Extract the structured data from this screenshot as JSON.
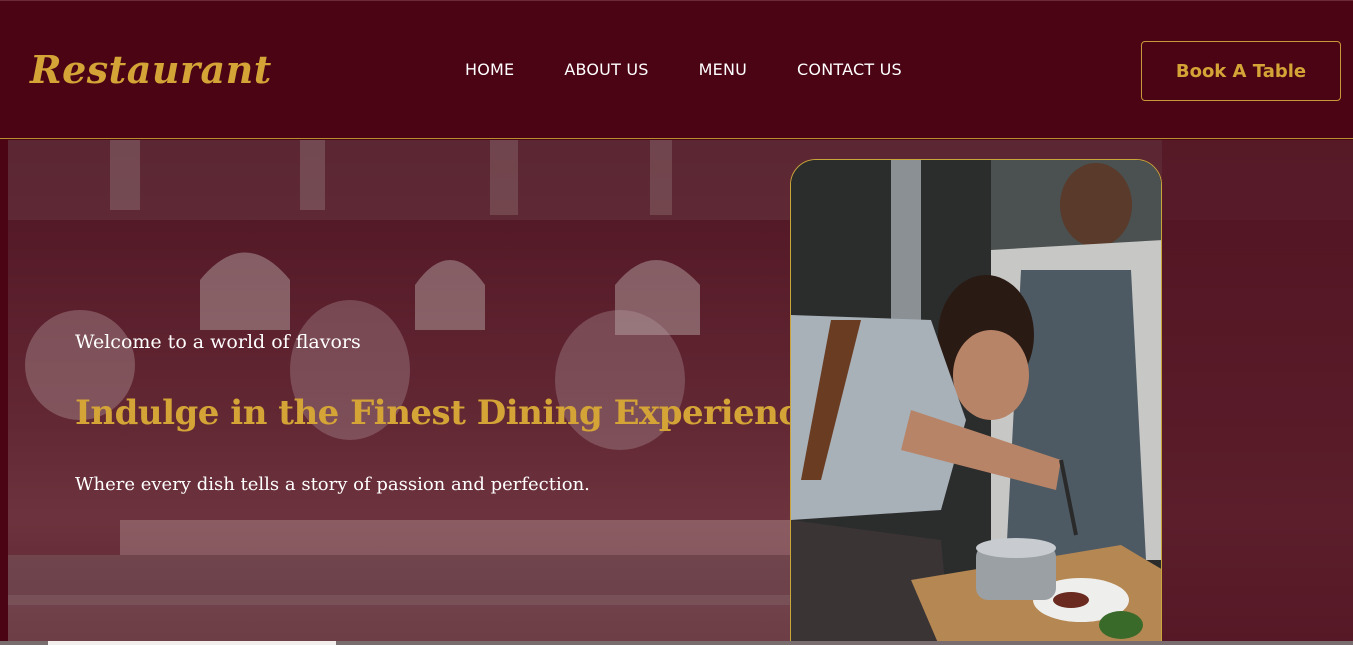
{
  "header": {
    "logo": "Restaurant",
    "nav": [
      {
        "label": "HOME"
      },
      {
        "label": "ABOUT US"
      },
      {
        "label": "MENU"
      },
      {
        "label": "CONTACT US"
      }
    ],
    "cta_label": "Book A Table"
  },
  "hero": {
    "subtitle": "Welcome to a world of flavors",
    "title": "Indulge in the Finest Dining Experience",
    "description": "Where every dish tells a story of passion and perfection."
  },
  "colors": {
    "background": "#4a0414",
    "accent_gold": "#d4a437",
    "text_white": "#ffffff"
  }
}
